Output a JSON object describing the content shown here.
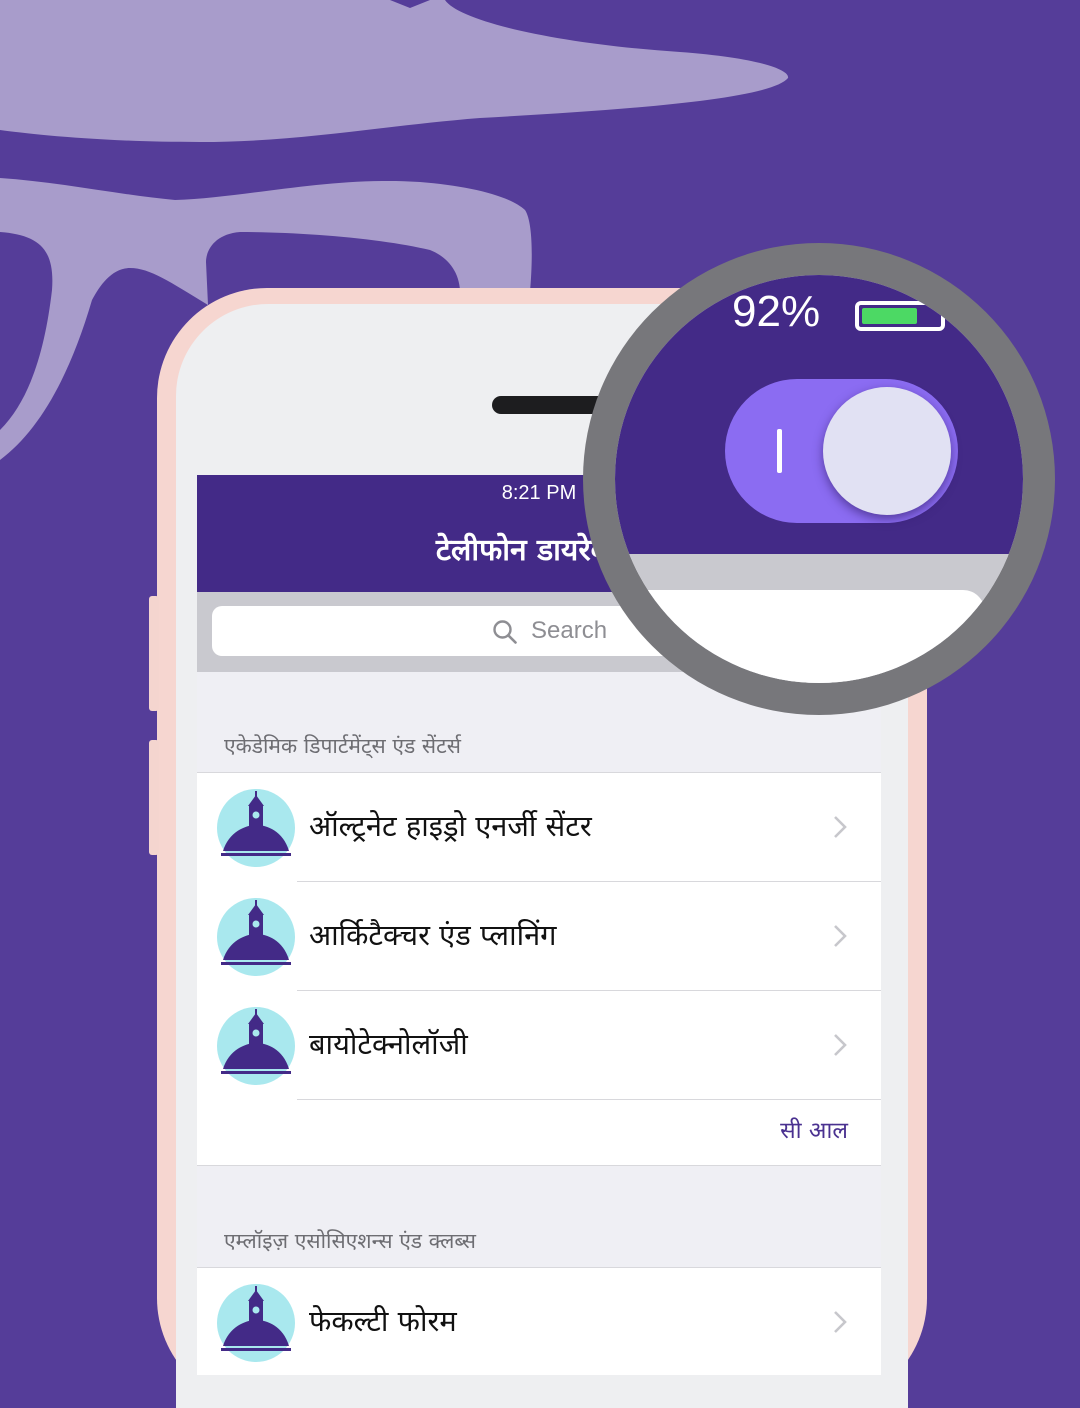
{
  "status_bar": {
    "time": "8:21 PM",
    "battery_percent_text": "92%"
  },
  "nav": {
    "title": "टेलीफोन डायरेक्टरी"
  },
  "search": {
    "placeholder": "Search"
  },
  "toggle": {
    "state": "on"
  },
  "sections": [
    {
      "header": "एकेडेमिक डिपार्टमेंट्स एंड सेंटर्स",
      "items": [
        {
          "label": "ऑल्ट्रनेट हाइड्रो एनर्जी सेंटर",
          "icon": "building-dome-icon"
        },
        {
          "label": "आर्किटैक्चर एंड प्लानिंग",
          "icon": "building-dome-icon"
        },
        {
          "label": "बायोटेक्नोलॉजी",
          "icon": "building-dome-icon"
        }
      ],
      "see_all": "सी आल"
    },
    {
      "header": "एम्लॉइज़ एसोसिएशन्स एंड क्लब्स",
      "items": [
        {
          "label": "फेकल्टी फोरम",
          "icon": "building-dome-icon"
        }
      ]
    }
  ],
  "colors": {
    "background": "#553d99",
    "navbar": "#432a87",
    "toggle_on": "#8b6cf2",
    "avatar_bg": "#a9e8ee",
    "accent_text": "#4a3190",
    "battery_fill": "#4cd964"
  }
}
